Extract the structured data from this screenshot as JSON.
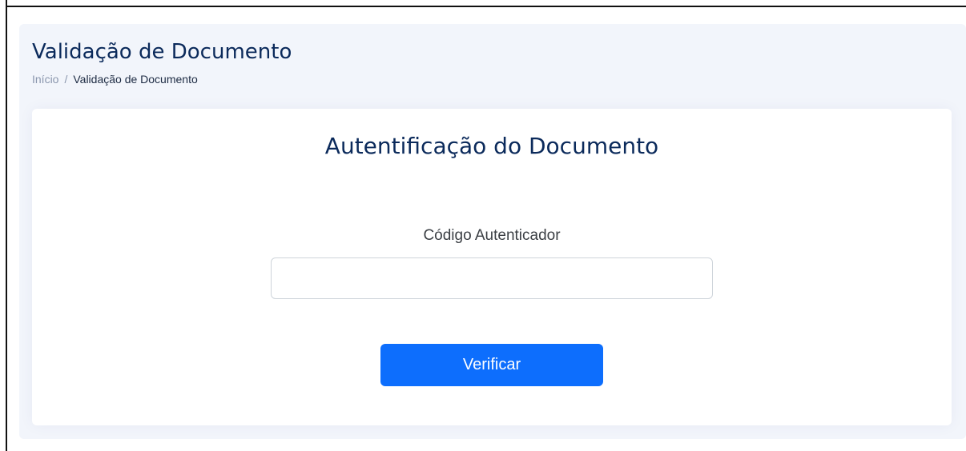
{
  "header": {
    "title": "Validação de Documento"
  },
  "breadcrumb": {
    "home": "Início",
    "separator": "/",
    "current": "Validação de Documento"
  },
  "card": {
    "title": "Autentificação do Documento",
    "field_label": "Código Autenticador",
    "input_value": "",
    "input_placeholder": "",
    "button_label": "Verificar"
  },
  "colors": {
    "title": "#0b2a5b",
    "page_background": "#f2f5fb",
    "button": "#0d6efd"
  }
}
